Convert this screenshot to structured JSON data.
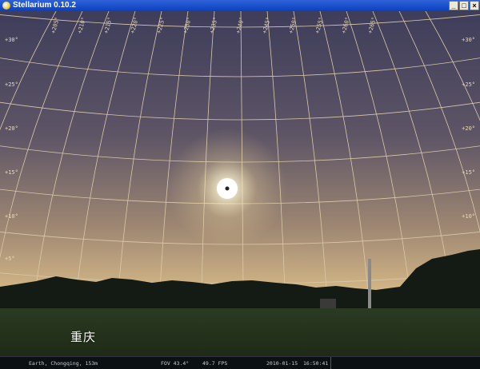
{
  "window": {
    "title": "Stellarium 0.10.2",
    "minimize_label": "_",
    "maximize_label": "□",
    "close_label": "×"
  },
  "sky": {
    "azimuth_labels": [
      "+205°",
      "+210°",
      "+215°",
      "+220°",
      "+225°",
      "+230°",
      "+235°",
      "+240°",
      "+245°",
      "+250°",
      "+255°",
      "+260°",
      "+265°"
    ],
    "altitude_labels": [
      "+5°",
      "+10°",
      "+15°",
      "+20°",
      "+25°",
      "+30°"
    ],
    "location_label": "重庆"
  },
  "status": {
    "location": "Earth, Chongqing, 153m",
    "fov": "FOV 43.4°",
    "fps": "49.7 FPS",
    "date": "2010-01-15",
    "time": "16:50:41"
  },
  "colors": {
    "titlebar": "#0a3fc0",
    "grid_line": "#d9c9a8",
    "sun": "#ffffff",
    "sky_top": "#3e3d5a",
    "sky_horizon": "#d8bb88",
    "ground": "#223018"
  }
}
